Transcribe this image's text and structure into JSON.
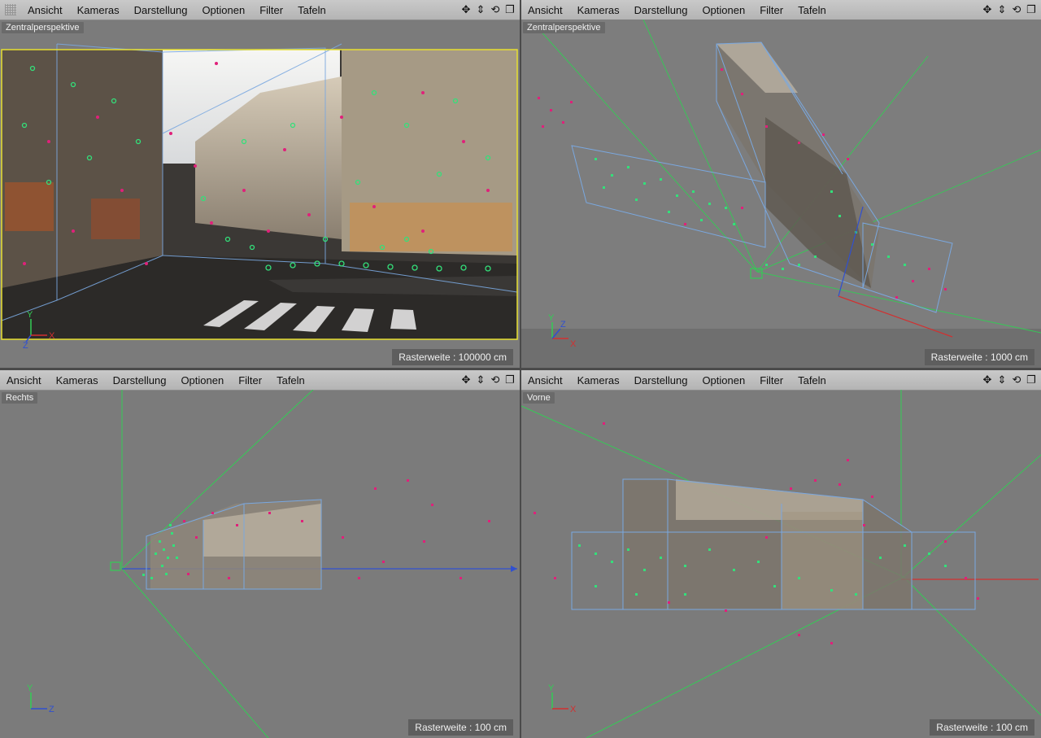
{
  "menu": [
    "Ansicht",
    "Kameras",
    "Darstellung",
    "Optionen",
    "Filter",
    "Tafeln"
  ],
  "toolbar_icons": [
    "move-icon",
    "zoom-icon",
    "rotate-icon",
    "maximize-icon"
  ],
  "viewports": {
    "top_left": {
      "label": "Zentralperspektive",
      "raster": "Rasterweite : 100000 cm"
    },
    "top_right": {
      "label": "Zentralperspektive",
      "raster": "Rasterweite : 1000 cm"
    },
    "bottom_left": {
      "label": "Rechts",
      "raster": "Rasterweite : 100 cm"
    },
    "bottom_right": {
      "label": "Vorne",
      "raster": "Rasterweite : 100 cm"
    }
  },
  "axes": {
    "y": "Y",
    "x": "X",
    "z": "Z"
  },
  "colors": {
    "tracker_green": "#33e07a",
    "tracker_pink": "#e0207a",
    "wire_blue": "#7aa8e0",
    "guide_green": "#33cc55",
    "axis_red": "#d23030",
    "axis_blue": "#3050d0",
    "safe_frame": "#e8e030"
  }
}
